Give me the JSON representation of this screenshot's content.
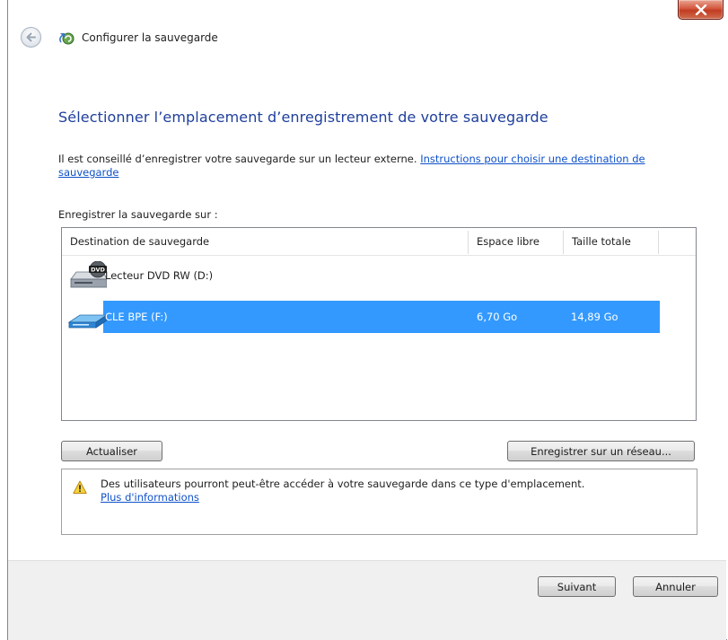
{
  "window": {
    "title": "Configurer la sauvegarde"
  },
  "page": {
    "heading": "Sélectionner l’emplacement d’enregistrement de votre sauvegarde",
    "intro_text": "Il est conseillé d’enregistrer votre sauvegarde sur un lecteur externe. ",
    "intro_link": "Instructions pour choisir une destination de sauvegarde",
    "save_on_label": "Enregistrer la sauvegarde sur :"
  },
  "destinations": {
    "columns": {
      "destination": "Destination de sauvegarde",
      "free": "Espace libre",
      "total": "Taille totale"
    },
    "rows": [
      {
        "name": "Lecteur DVD RW (D:)",
        "free": "",
        "total": "",
        "icon": "dvd-drive-icon",
        "selected": false
      },
      {
        "name": "CLE BPE (F:)",
        "free": "6,70 Go",
        "total": "14,89 Go",
        "icon": "usb-drive-icon",
        "selected": true
      }
    ]
  },
  "buttons": {
    "refresh": "Actualiser",
    "network": "Enregistrer sur un réseau...",
    "next": "Suivant",
    "cancel": "Annuler"
  },
  "warning": {
    "text": "Des utilisateurs pourront peut-être accéder à votre sauvegarde dans ce type d'emplacement.",
    "link": "Plus d'informations",
    "icon": "warning-icon"
  },
  "colors": {
    "heading": "#1f3f9b",
    "link": "#0f51c8",
    "selection": "#3399ff",
    "close": "#c13b21"
  }
}
